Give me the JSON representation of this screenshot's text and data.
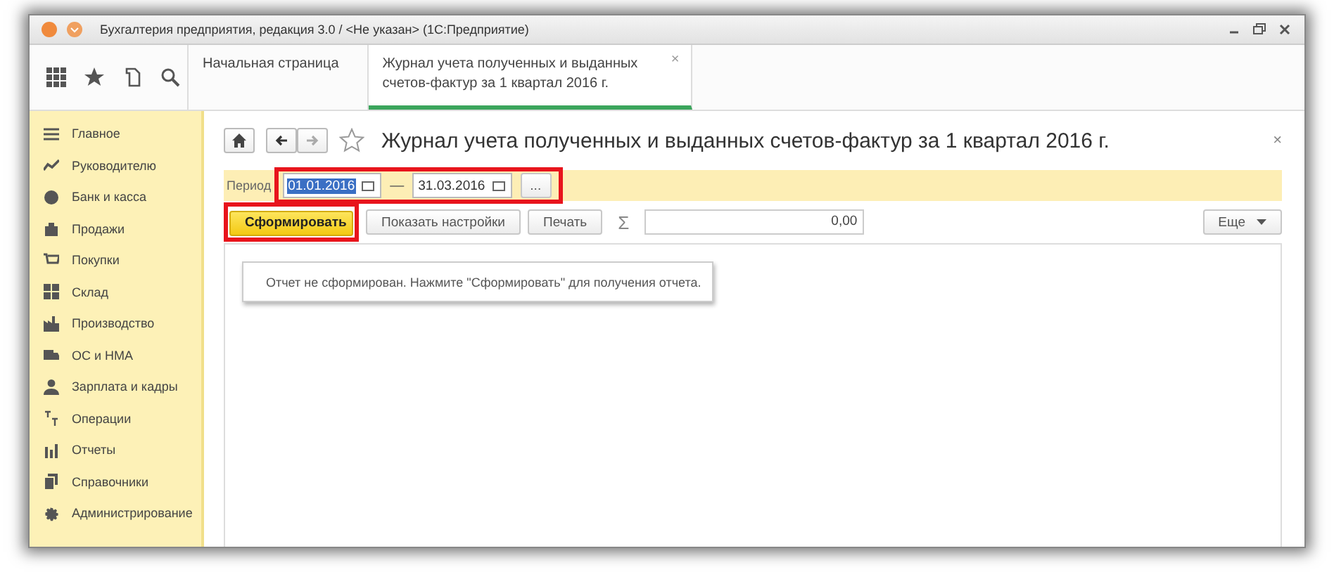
{
  "window": {
    "title": "Бухгалтерия предприятия, редакция 3.0 / <Не указан>  (1С:Предприятие)"
  },
  "tabs": [
    {
      "label": "Начальная страница",
      "selected": false
    },
    {
      "label": "Журнал учета полученных и выданных счетов-фактур за 1 квартал 2016 г.",
      "selected": true,
      "close": "×"
    }
  ],
  "sidebar": {
    "items": [
      {
        "label": "Главное"
      },
      {
        "label": "Руководителю"
      },
      {
        "label": "Банк и касса"
      },
      {
        "label": "Продажи"
      },
      {
        "label": "Покупки"
      },
      {
        "label": "Склад"
      },
      {
        "label": "Производство"
      },
      {
        "label": "ОС и НМА"
      },
      {
        "label": "Зарплата и кадры"
      },
      {
        "label": "Операции"
      },
      {
        "label": "Отчеты"
      },
      {
        "label": "Справочники"
      },
      {
        "label": "Администрирование"
      }
    ]
  },
  "form": {
    "title": "Журнал учета полученных и выданных счетов-фактур за 1 квартал 2016 г.",
    "close": "×",
    "period": {
      "label": "Период",
      "start": {
        "value": "01.01.2016",
        "text_selected": true
      },
      "dash": "—",
      "end": {
        "value": "31.03.2016",
        "text_selected": false
      },
      "more": "..."
    },
    "toolbar": {
      "buttons": [
        {
          "label": "Сформировать",
          "kind": "primary"
        },
        {
          "label": "Показать настройки",
          "kind": "normal"
        },
        {
          "label": "Печать",
          "kind": "normal"
        }
      ],
      "sum_sign": "Σ",
      "sum": "0,00",
      "more": "Еще"
    },
    "message": "Отчет не сформирован. Нажмите \"Сформировать\" для получения отчета."
  }
}
